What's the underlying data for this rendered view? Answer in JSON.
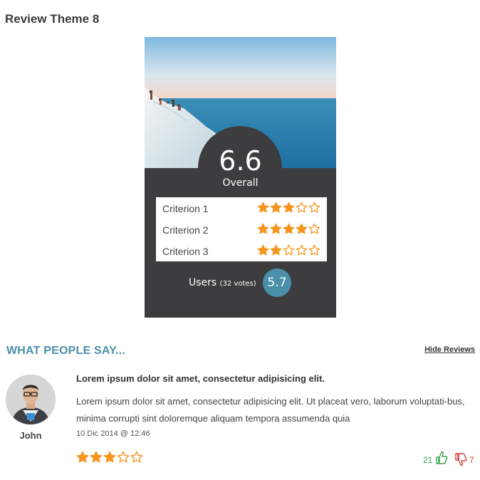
{
  "page": {
    "title": "Review Theme 8"
  },
  "review_card": {
    "overall_score": "6.6",
    "overall_label": "Overall",
    "criteria": [
      {
        "label": "Criterion 1",
        "rating": 3,
        "max": 5
      },
      {
        "label": "Criterion 2",
        "rating": 4,
        "max": 5
      },
      {
        "label": "Criterion 3",
        "rating": 2,
        "max": 5
      }
    ],
    "users_label": "Users",
    "users_votes": "(32 votes)",
    "users_score": "5.7"
  },
  "reviews_section": {
    "title": "WHAT PEOPLE SAY...",
    "hide_link": "Hide Reviews",
    "review": {
      "author": "John",
      "heading": "Lorem ipsum dolor sit amet, consectetur adipisicing elit.",
      "body": "Lorem ipsum dolor sit amet, consectetur adipisicing elit. Ut placeat vero, laborum voluptati-bus, minima corrupti sint doloremque aliquam tempora assumenda quia",
      "date": "10 Dic 2014 @ 12:46",
      "rating": 3,
      "max": 5,
      "likes": "21",
      "dislikes": "7"
    }
  },
  "colors": {
    "star": "#f7941d",
    "accent": "#4a90a8",
    "card_bg": "#3d3d3f",
    "like": "#3fa34d",
    "dislike": "#d43b3b"
  },
  "icons": {
    "like": "thumbs-up-icon",
    "dislike": "thumbs-down-icon",
    "star": "star-icon"
  }
}
